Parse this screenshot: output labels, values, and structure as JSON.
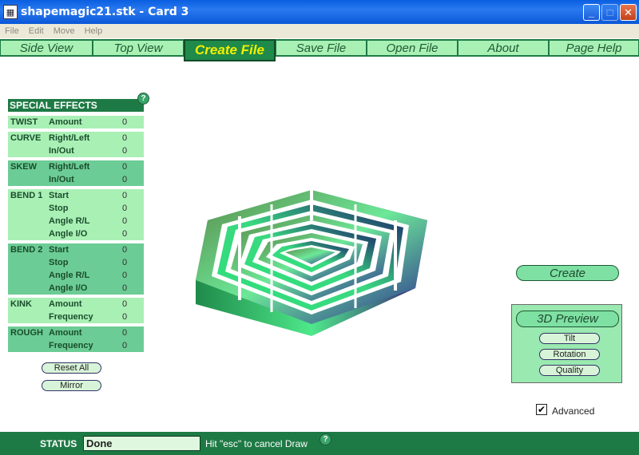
{
  "window": {
    "title": "shapemagic21.stk - Card 3",
    "minimize": "_",
    "maximize": "□",
    "close": "✕"
  },
  "menu": [
    "File",
    "Edit",
    "Move",
    "Help"
  ],
  "nav": {
    "tabs": [
      "Side View",
      "Top View",
      "Create File",
      "Save File",
      "Open File",
      "About",
      "Page Help"
    ],
    "active": "Create File"
  },
  "effects": {
    "header": "SPECIAL EFFECTS",
    "help": "?",
    "groups": [
      {
        "name": "TWIST",
        "rows": [
          {
            "param": "Amount",
            "value": "0"
          }
        ]
      },
      {
        "name": "CURVE",
        "rows": [
          {
            "param": "Right/Left",
            "value": "0"
          },
          {
            "param": "In/Out",
            "value": "0"
          }
        ]
      },
      {
        "name": "SKEW",
        "rows": [
          {
            "param": "Right/Left",
            "value": "0"
          },
          {
            "param": "In/Out",
            "value": "0"
          }
        ]
      },
      {
        "name": "BEND 1",
        "rows": [
          {
            "param": "Start",
            "value": "0"
          },
          {
            "param": "Stop",
            "value": "0"
          },
          {
            "param": "Angle R/L",
            "value": "0"
          },
          {
            "param": "Angle I/O",
            "value": "0"
          }
        ]
      },
      {
        "name": "BEND 2",
        "rows": [
          {
            "param": "Start",
            "value": "0"
          },
          {
            "param": "Stop",
            "value": "0"
          },
          {
            "param": "Angle R/L",
            "value": "0"
          },
          {
            "param": "Angle I/O",
            "value": "0"
          }
        ]
      },
      {
        "name": "KINK",
        "rows": [
          {
            "param": "Amount",
            "value": "0"
          },
          {
            "param": "Frequency",
            "value": "0"
          }
        ]
      },
      {
        "name": "ROUGH",
        "rows": [
          {
            "param": "Amount",
            "value": "0"
          },
          {
            "param": "Frequency",
            "value": "0"
          }
        ]
      }
    ],
    "reset_label": "Reset All",
    "mirror_label": "Mirror"
  },
  "actions": {
    "create_label": "Create"
  },
  "preview": {
    "title": "3D Preview",
    "tilt": "Tilt",
    "rotation": "Rotation",
    "quality": "Quality"
  },
  "advanced": {
    "label": "Advanced",
    "checked": true,
    "check_mark": "✔"
  },
  "status": {
    "label": "STATUS",
    "value": "Done",
    "hint": "Hit \"esc\" to cancel Draw",
    "help": "?"
  },
  "colors": {
    "panel_dark": "#1e7a45",
    "panel_light": "#a9f0b5",
    "panel_mid": "#6ccc95",
    "active_tab_text": "#f2f000"
  },
  "icons": {
    "app": "app-icon",
    "help": "help-icon",
    "check": "checkmark-icon"
  }
}
